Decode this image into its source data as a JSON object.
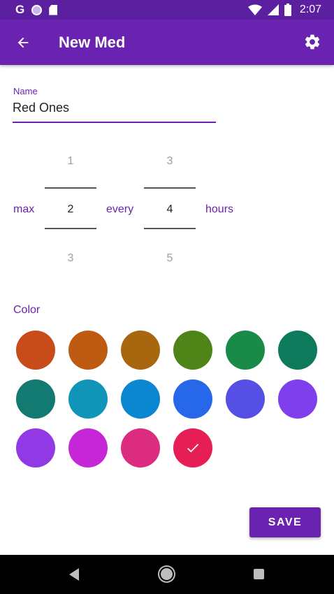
{
  "status_bar": {
    "left_icons": [
      "google-icon",
      "notification-circle-icon",
      "sd-card-icon"
    ],
    "google_glyph": "G",
    "right_icons": [
      "wifi-icon",
      "signal-icon",
      "battery-icon"
    ],
    "time": "2:07"
  },
  "app_bar": {
    "title": "New Med",
    "back_icon": "arrow-back-icon",
    "settings_icon": "gear-icon",
    "color": "#6a22b0"
  },
  "form": {
    "name_label": "Name",
    "name_value": "Red Ones",
    "max_label": "max",
    "every_label": "every",
    "hours_label": "hours",
    "max_picker": {
      "above": "1",
      "selected": "2",
      "below": "3"
    },
    "hours_picker": {
      "above": "3",
      "selected": "4",
      "below": "5"
    },
    "color_label": "Color"
  },
  "colors": [
    {
      "hex": "#c84b1a",
      "selected": false
    },
    {
      "hex": "#bf5a12",
      "selected": false
    },
    {
      "hex": "#a8670f",
      "selected": false
    },
    {
      "hex": "#4f8418",
      "selected": false
    },
    {
      "hex": "#1a8a48",
      "selected": false
    },
    {
      "hex": "#0d7a5c",
      "selected": false
    },
    {
      "hex": "#127a70",
      "selected": false
    },
    {
      "hex": "#1095b8",
      "selected": false
    },
    {
      "hex": "#0b87d1",
      "selected": false
    },
    {
      "hex": "#2767ea",
      "selected": false
    },
    {
      "hex": "#554fe6",
      "selected": false
    },
    {
      "hex": "#7f3fec",
      "selected": false
    },
    {
      "hex": "#9239e6",
      "selected": false
    },
    {
      "hex": "#c527d6",
      "selected": false
    },
    {
      "hex": "#dc2c7f",
      "selected": false
    },
    {
      "hex": "#e61e56",
      "selected": true
    }
  ],
  "actions": {
    "save_label": "SAVE"
  },
  "nav_bar": {
    "icons": [
      "nav-back-icon",
      "nav-home-icon",
      "nav-recents-icon"
    ]
  }
}
